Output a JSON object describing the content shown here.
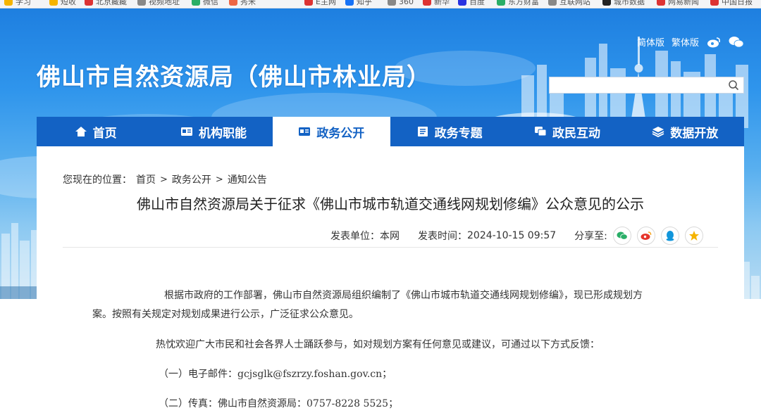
{
  "bookmarks": [
    {
      "label": "学习",
      "color": "#f5b400"
    },
    {
      "label": "短收",
      "color": "#f5b400"
    },
    {
      "label": "北京藏藏",
      "color": "#d33"
    },
    {
      "label": "视频地址",
      "color": "#888"
    },
    {
      "label": "微信",
      "color": "#2aae67"
    },
    {
      "label": "秀米",
      "color": "#e64"
    },
    {
      "label": "E主网",
      "color": "#d33"
    },
    {
      "label": "知乎",
      "color": "#1772f6"
    },
    {
      "label": "360",
      "color": "#888"
    },
    {
      "label": "新华",
      "color": "#d33"
    },
    {
      "label": "百度",
      "color": "#2932e1"
    },
    {
      "label": "东方财富",
      "color": "#2aae67"
    },
    {
      "label": "互联网站",
      "color": "#888"
    },
    {
      "label": "城市数据",
      "color": "#222"
    },
    {
      "label": "网易新闻",
      "color": "#d33"
    },
    {
      "label": "中国日报",
      "color": "#d33"
    }
  ],
  "header": {
    "title": "佛山市自然资源局（佛山市林业局）",
    "links": [
      "简体版",
      "繁体版"
    ],
    "icons": [
      "weibo-icon",
      "wechat-icon"
    ],
    "search_placeholder": ""
  },
  "nav": {
    "items": [
      {
        "label": "首页",
        "icon": "home-icon",
        "active": false
      },
      {
        "label": "机构职能",
        "icon": "id-card-icon",
        "active": false
      },
      {
        "label": "政务公开",
        "icon": "id-card-icon",
        "active": true
      },
      {
        "label": "政务专题",
        "icon": "document-icon",
        "active": false
      },
      {
        "label": "政民互动",
        "icon": "chat-icon",
        "active": false
      },
      {
        "label": "数据开放",
        "icon": "layers-icon",
        "active": false
      }
    ]
  },
  "breadcrumb": {
    "prefix": "您现在的位置：",
    "items": [
      "首页",
      "政务公开",
      "通知公告"
    ],
    "separator": ">"
  },
  "article": {
    "title": "佛山市自然资源局关于征求《佛山市城市轨道交通线网规划修编》公众意见的公示",
    "publisher_label": "发表单位：",
    "publisher": "本网",
    "time_label": "发表时间：",
    "time": "2024-10-15 09:57",
    "share_label": "分享至:",
    "share_icons": [
      "wechat-icon",
      "weibo-icon",
      "qq-icon",
      "qzone-icon"
    ],
    "paragraphs": [
      "根据市政府的工作部署，佛山市自然资源局组织编制了《佛山市城市轨道交通线网规划修编》，现已形成规划方",
      "案。按照有关规定对规划成果进行公示，广泛征求公众意见。",
      "热忱欢迎广大市民和社会各界人士踊跃参与，如对规划方案有任何意见或建议，可通过以下方式反馈：",
      "（一）电子邮件：gcjsglk@fszrzy.foshan.gov.cn；",
      "（二）传真：佛山市自然资源局：0757-8228 5525；"
    ]
  },
  "colors": {
    "nav_bg": "#1362c4",
    "banner_top": "#1e7fe0",
    "banner_bottom": "#b9dcf3",
    "share_wechat": "#2aae67",
    "share_weibo": "#e6352b",
    "share_qq": "#1296db",
    "share_qzone": "#f5b400"
  }
}
